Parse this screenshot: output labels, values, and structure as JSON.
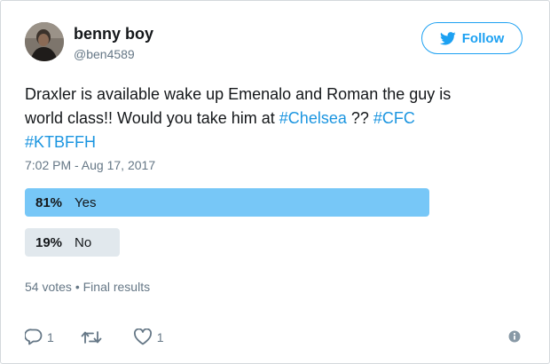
{
  "user": {
    "display_name": "benny boy",
    "handle": "@ben4589",
    "avatar_icon": "profile-photo"
  },
  "follow_button": {
    "label": "Follow",
    "icon": "twitter-bird-icon",
    "color": "#1da1f2"
  },
  "tweet": {
    "line1": "Draxler is available wake up Emenalo and Roman the guy is",
    "line2_text": "world class!! Would you take him at ",
    "hashtag_chelsea": "#Chelsea",
    "line2_mid": " ?? ",
    "hashtag_cfc": "#CFC",
    "hashtag_ktbffh": "#KTBFFH",
    "timestamp": "7:02 PM - Aug 17, 2017",
    "hashtag_color": "#1b95e0"
  },
  "poll": {
    "choices": [
      {
        "percent": "81%",
        "label": "Yes",
        "value": 0.81,
        "winner": true
      },
      {
        "percent": "19%",
        "label": "No",
        "value": 0.19,
        "winner": false
      }
    ],
    "votes": "54 votes",
    "separator": "•",
    "status": "Final results",
    "winner_color": "#77c7f7",
    "other_color": "#e1e8ed"
  },
  "actions": {
    "reply": {
      "icon": "reply-icon",
      "count": "1"
    },
    "retweet": {
      "icon": "retweet-icon",
      "count": ""
    },
    "like": {
      "icon": "heart-icon",
      "count": "1"
    },
    "info": {
      "icon": "info-icon"
    }
  }
}
